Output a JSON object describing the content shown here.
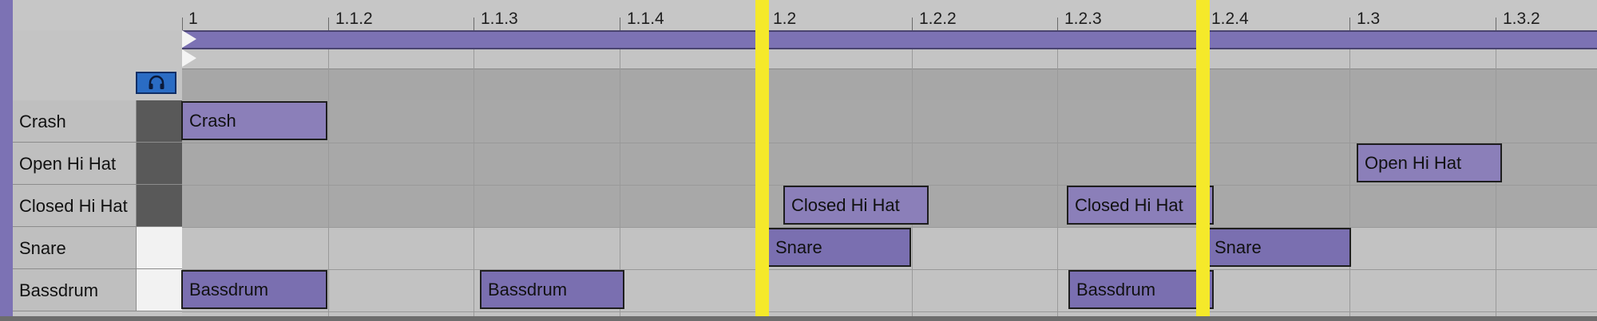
{
  "ruler": {
    "labels": [
      "1",
      "1.1.2",
      "1.1.3",
      "1.1.4",
      "1.2",
      "1.2.2",
      "1.2.3",
      "1.2.4",
      "1.3",
      "1.3.2"
    ]
  },
  "tracks": [
    {
      "name": "Crash"
    },
    {
      "name": "Open Hi Hat"
    },
    {
      "name": "Closed Hi Hat"
    },
    {
      "name": "Snare"
    },
    {
      "name": "Bassdrum"
    }
  ],
  "clips": [
    {
      "label": "Crash"
    },
    {
      "label": "Open Hi Hat"
    },
    {
      "label": "Closed Hi Hat"
    },
    {
      "label": "Closed Hi Hat"
    },
    {
      "label": "Snare"
    },
    {
      "label": "Snare"
    },
    {
      "label": "Bassdrum"
    },
    {
      "label": "Bassdrum"
    },
    {
      "label": "Bassdrum"
    }
  ],
  "icons": {
    "solo_headphone": "headphone-icon",
    "marker": "marker-flag-icon"
  },
  "colors": {
    "clip": "#8b7fb9",
    "loop": "#7c72b4",
    "playhead": "#f5e92a",
    "solo_button": "#2a6cc4"
  }
}
